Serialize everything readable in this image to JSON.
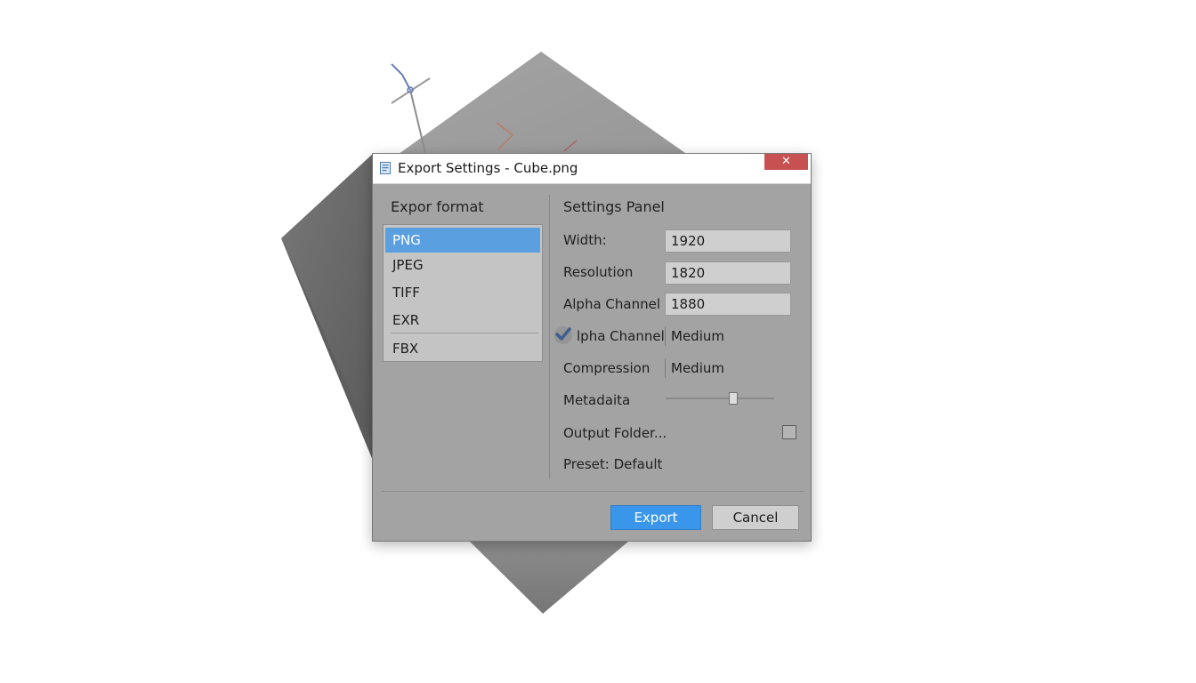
{
  "dialog": {
    "title": "Export Settings - Cube.png",
    "close_label": "✕"
  },
  "left_panel": {
    "heading": "Expor format",
    "formats": [
      "PNG",
      "JPEG",
      "TIFF",
      "EXR",
      "FBX"
    ],
    "selected": "PNG"
  },
  "settings": {
    "heading": "Settings Panel",
    "width": {
      "label": "Width:",
      "value": "1920"
    },
    "resolution": {
      "label": "Resolution",
      "value": "1820"
    },
    "alpha_channel": {
      "label": "Alpha Channel",
      "value": "1880"
    },
    "alpha_channel_2": {
      "label": "lpha Channel",
      "value": "Medium",
      "checked": true
    },
    "compression": {
      "label": "Compression",
      "value": "Medium"
    },
    "metadata": {
      "label": "Metadaita",
      "slider_level": 0.62
    },
    "output_folder": {
      "label": "Output Folder...",
      "checked": false
    },
    "preset": {
      "label": "Preset: Default"
    }
  },
  "buttons": {
    "export": "Export",
    "cancel": "Cancel"
  },
  "colors": {
    "accent": "#3a96ea",
    "selection": "#5a9fe0",
    "close": "#c75050",
    "dialog_bg": "#a3a3a3"
  },
  "icons": {
    "title": "document-icon",
    "checkbox": "checkmark-icon"
  }
}
